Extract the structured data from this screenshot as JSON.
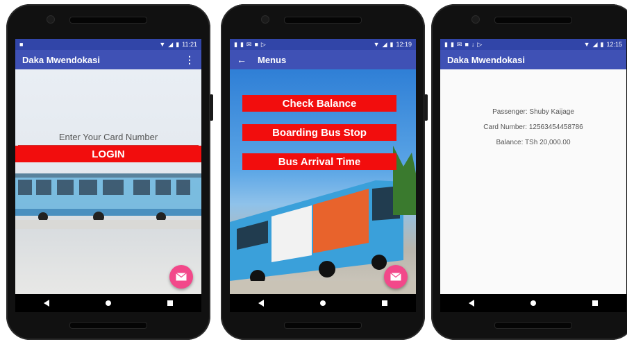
{
  "screens": [
    {
      "statusbar": {
        "time": "11:21"
      },
      "appbar": {
        "title": "Daka Mwendokasi",
        "menu_icon": "overflow-menu-icon"
      },
      "card_input": {
        "placeholder": "Enter Your Card Number"
      },
      "login_label": "LOGIN",
      "fab_icon": "email-icon"
    },
    {
      "statusbar": {
        "time": "12:19"
      },
      "appbar": {
        "title": "Menus",
        "back_icon": "back-arrow-icon"
      },
      "menu": [
        {
          "label": "Check Balance"
        },
        {
          "label": "Boarding Bus Stop"
        },
        {
          "label": "Bus Arrival Time"
        }
      ],
      "fab_icon": "email-icon"
    },
    {
      "statusbar": {
        "time": "12:15"
      },
      "appbar": {
        "title": "Daka Mwendokasi"
      },
      "passenger": "Passenger: Shuby Kaijage",
      "card_number": "Card Number: 12563454458786",
      "balance": "Balance: TSh 20,000.00"
    }
  ],
  "colors": {
    "appbar": "#3f51b5",
    "statusbar": "#3145a8",
    "button_red": "#f20d0d",
    "fab_pink": "#f2488a"
  }
}
